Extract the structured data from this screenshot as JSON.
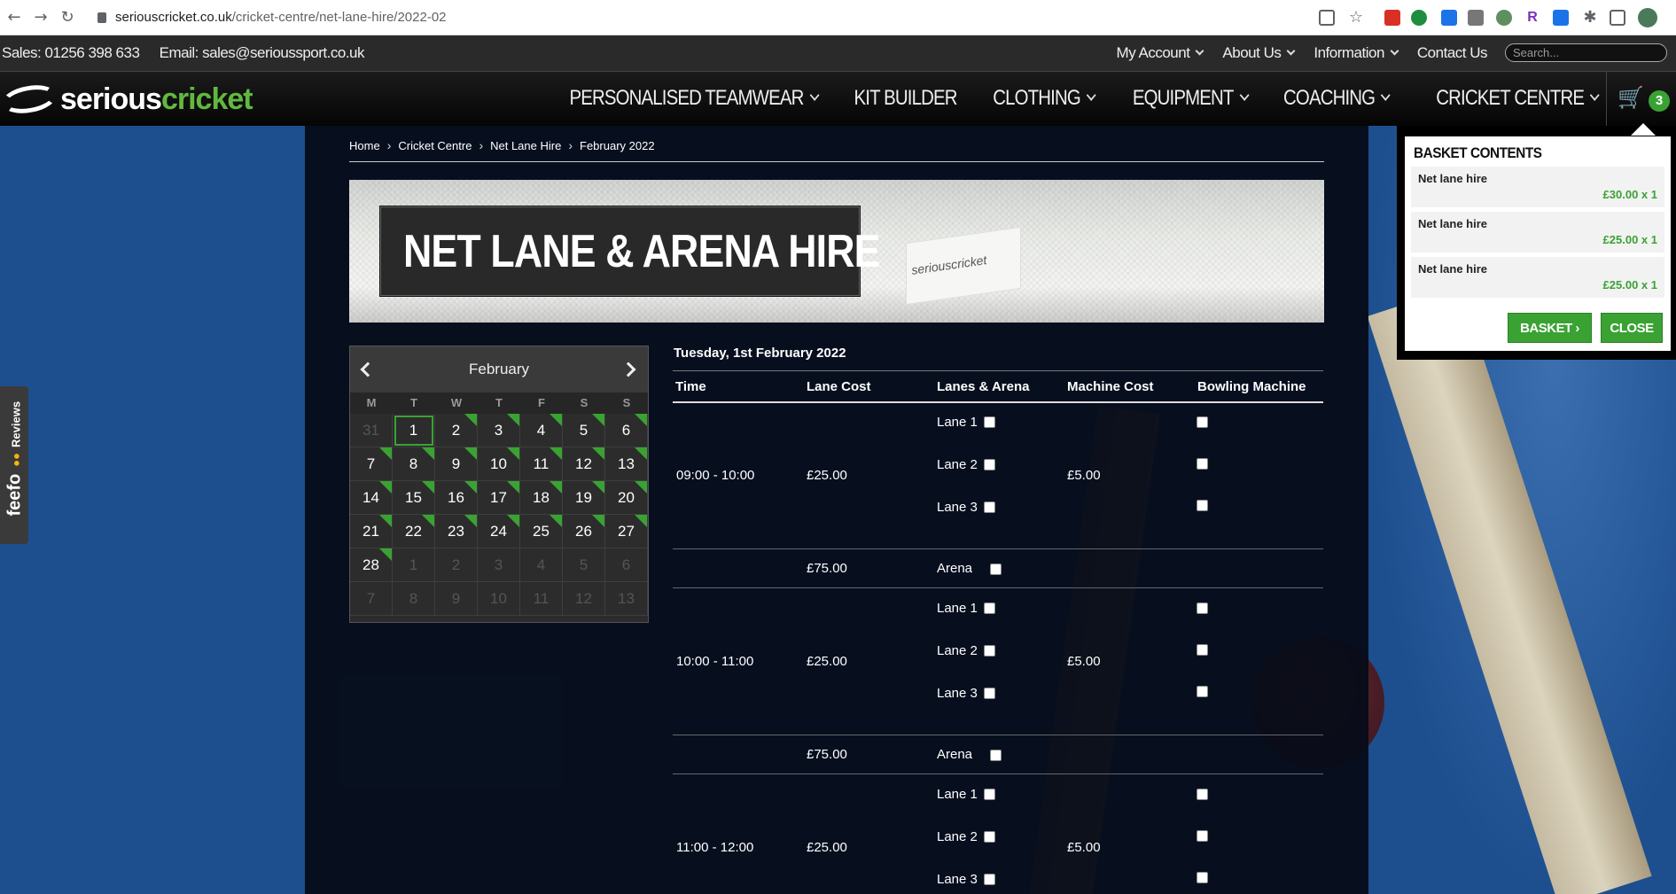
{
  "browser": {
    "url_domain": "seriouscricket.co.uk",
    "url_path": "/cricket-centre/net-lane-hire/2022-02"
  },
  "topbar": {
    "sales": "Sales: 01256 398 633",
    "email": "Email: sales@serioussport.co.uk",
    "links": [
      "My Account",
      "About Us",
      "Information",
      "Contact Us"
    ],
    "search_placeholder": "Search..."
  },
  "logo": {
    "word1": "serious",
    "word2": "cricket"
  },
  "mainnav": {
    "items": [
      "PERSONALISED TEAMWEAR",
      "KIT BUILDER",
      "CLOTHING",
      "EQUIPMENT",
      "COACHING",
      "CRICKET CENTRE"
    ],
    "cart_count": "3"
  },
  "breadcrumb": [
    "Home",
    "Cricket Centre",
    "Net Lane Hire",
    "February 2022"
  ],
  "hero": {
    "title": "NET LANE & ARENA HIRE",
    "sign_text": "seriouscricket"
  },
  "calendar": {
    "month": "February",
    "weekdays": [
      "M",
      "T",
      "W",
      "T",
      "F",
      "S",
      "S"
    ],
    "weeks": [
      [
        "31",
        "1",
        "2",
        "3",
        "4",
        "5",
        "6"
      ],
      [
        "7",
        "8",
        "9",
        "10",
        "11",
        "12",
        "13"
      ],
      [
        "14",
        "15",
        "16",
        "17",
        "18",
        "19",
        "20"
      ],
      [
        "21",
        "22",
        "23",
        "24",
        "25",
        "26",
        "27"
      ],
      [
        "28",
        "1",
        "2",
        "3",
        "4",
        "5",
        "6"
      ],
      [
        "7",
        "8",
        "9",
        "10",
        "11",
        "12",
        "13"
      ]
    ]
  },
  "schedule": {
    "date": "Tuesday, 1st February 2022",
    "headers": [
      "Time",
      "Lane Cost",
      "Lanes & Arena",
      "Machine Cost",
      "Bowling Machine"
    ],
    "slots": [
      {
        "time": "09:00 - 10:00",
        "lane_cost": "£25.00",
        "lanes": [
          "Lane 1",
          "Lane 2",
          "Lane 3"
        ],
        "machine_cost": "£5.00",
        "arena_cost": "£75.00",
        "arena": "Arena"
      },
      {
        "time": "10:00 - 11:00",
        "lane_cost": "£25.00",
        "lanes": [
          "Lane 1",
          "Lane 2",
          "Lane 3"
        ],
        "machine_cost": "£5.00",
        "arena_cost": "£75.00",
        "arena": "Arena"
      },
      {
        "time": "11:00 - 12:00",
        "lane_cost": "£25.00",
        "lanes": [
          "Lane 1",
          "Lane 2",
          "Lane 3"
        ],
        "machine_cost": "£5.00"
      }
    ]
  },
  "basket": {
    "title": "BASKET CONTENTS",
    "items": [
      {
        "name": "Net lane hire",
        "price": "£30.00 x 1"
      },
      {
        "name": "Net lane hire",
        "price": "£25.00 x 1"
      },
      {
        "name": "Net lane hire",
        "price": "£25.00 x 1"
      }
    ],
    "basket_button": "BASKET",
    "close_button": "CLOSE"
  },
  "feefo": {
    "brand": "feefo",
    "label": "Reviews"
  },
  "colors": {
    "accent_green": "#3aa233",
    "background_blue": "#1d4f8f",
    "panel": "#060c18"
  }
}
